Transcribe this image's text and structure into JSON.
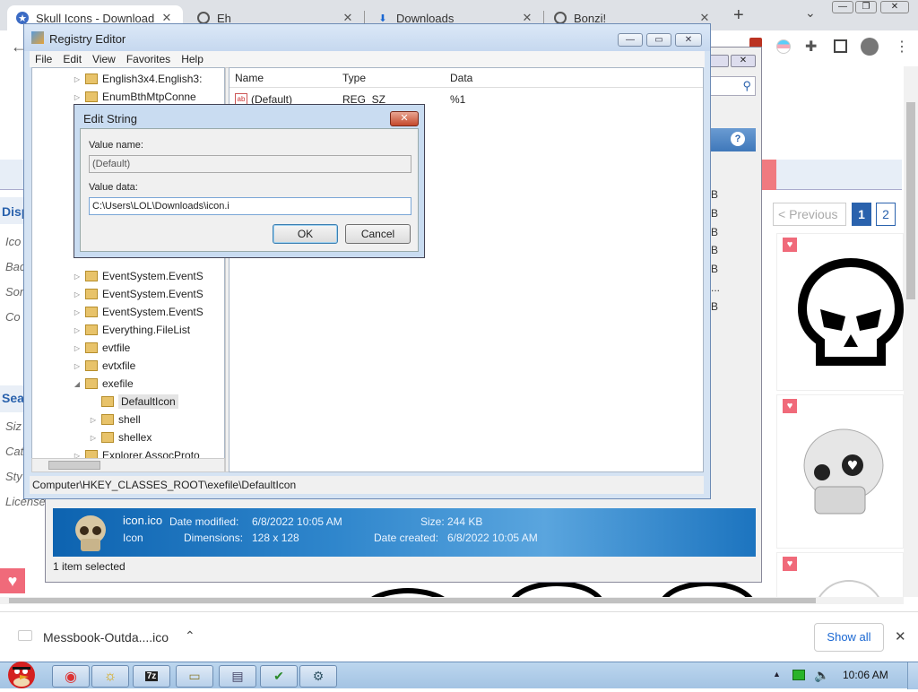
{
  "browser": {
    "tabs": [
      {
        "title": "Skull Icons - Download",
        "icon": "star-icon"
      },
      {
        "title": "Eh",
        "icon": "globe-icon"
      },
      {
        "title": "Downloads",
        "icon": "download-icon"
      },
      {
        "title": "Bonzi!",
        "icon": "globe-icon"
      }
    ],
    "new_tab": "+",
    "caret": "⌄",
    "win_min": "—",
    "win_max": "❐",
    "win_close": "✕"
  },
  "webpage": {
    "sidebar_labels": [
      "Disp",
      "Ico",
      "Bac",
      "Sor",
      "Co",
      "Sea",
      "Siz",
      "Cat",
      "Sty",
      "License"
    ],
    "pagination": {
      "previous": "< Previous",
      "page1": "1",
      "page2": "2"
    },
    "size_suffixes": [
      "B",
      "B",
      "B",
      "B",
      "B",
      "...",
      "B"
    ]
  },
  "registry": {
    "title": "Registry Editor",
    "menu": [
      "File",
      "Edit",
      "View",
      "Favorites",
      "Help"
    ],
    "tree": [
      {
        "label": "English3x4.English3:",
        "indent": 0,
        "exp": "▷"
      },
      {
        "label": "EnumBthMtpConne",
        "indent": 0,
        "exp": "▷"
      },
      {
        "label": "EventSystem.EventS",
        "indent": 0,
        "exp": "▷"
      },
      {
        "label": "EventSystem.EventS",
        "indent": 0,
        "exp": "▷"
      },
      {
        "label": "EventSystem.EventS",
        "indent": 0,
        "exp": "▷"
      },
      {
        "label": "Everything.FileList",
        "indent": 0,
        "exp": "▷"
      },
      {
        "label": "evtfile",
        "indent": 0,
        "exp": "▷"
      },
      {
        "label": "evtxfile",
        "indent": 0,
        "exp": "▷"
      },
      {
        "label": "exefile",
        "indent": 0,
        "exp": "◢"
      },
      {
        "label": "DefaultIcon",
        "indent": 1,
        "exp": "",
        "selected": true
      },
      {
        "label": "shell",
        "indent": 1,
        "exp": "▷"
      },
      {
        "label": "shellex",
        "indent": 1,
        "exp": "▷"
      },
      {
        "label": "Explorer.AssocProto",
        "indent": 0,
        "exp": "▷"
      }
    ],
    "columns": {
      "name": "Name",
      "type": "Type",
      "data": "Data"
    },
    "values": [
      {
        "name": "(Default)",
        "type": "REG_SZ",
        "data": "%1"
      }
    ],
    "status_path": "Computer\\HKEY_CLASSES_ROOT\\exefile\\DefaultIcon"
  },
  "explorer": {
    "details": {
      "filename": "icon.ico",
      "kind": "Icon",
      "modified_label": "Date modified:",
      "modified": "6/8/2022 10:05 AM",
      "dimensions_label": "Dimensions:",
      "dimensions": "128 x 128",
      "size_label": "Size:",
      "size": "244 KB",
      "created_label": "Date created:",
      "created": "6/8/2022 10:05 AM"
    },
    "status": "1 item selected"
  },
  "dialog": {
    "title": "Edit String",
    "value_name_label": "Value name:",
    "value_name": "(Default)",
    "value_data_label": "Value data:",
    "value_data": "C:\\Users\\LOL\\Downloads\\icon.i",
    "ok": "OK",
    "cancel": "Cancel",
    "close": "✕"
  },
  "download_bar": {
    "filename": "Messbook-Outda....ico",
    "caret": "⌃",
    "show_all": "Show all",
    "close": "✕"
  },
  "taskbar": {
    "apps": [
      "chrome-icon",
      "explorer-icon",
      "7zip-icon",
      "folder-icon",
      "notepad-icon",
      "security-icon",
      "regedit-icon"
    ],
    "app_labels": [
      "◉",
      "☼",
      "7z",
      "▭",
      "▤",
      "✔",
      "⚙"
    ],
    "clock": "10:06 AM",
    "tray_up": "▲"
  },
  "colors": {
    "accent": "#2a62ad",
    "download_bar_bg": "#ffffff",
    "details_pane": "#1c74bf",
    "heart_badge": "#f06a7a"
  }
}
